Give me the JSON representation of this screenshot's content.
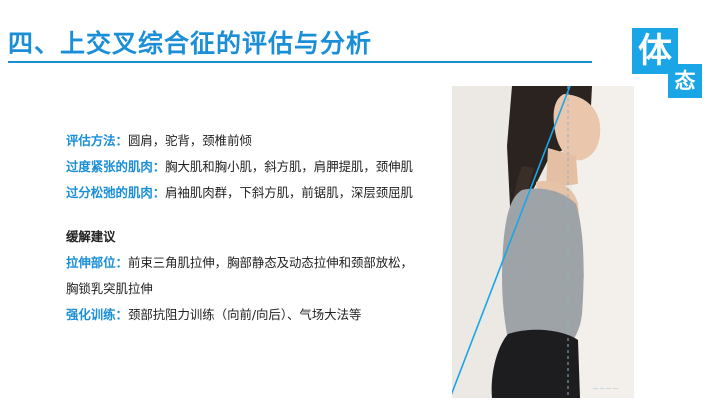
{
  "title": "四、上交叉综合征的评估与分析",
  "logo": {
    "big": "体",
    "small": "态"
  },
  "assessment": [
    {
      "label": "评估方法：",
      "text": "圆肩，驼背，颈椎前倾"
    },
    {
      "label": "过度紧张的肌肉：",
      "text": "胸大肌和胸小肌，斜方肌，肩胛提肌，颈伸肌"
    },
    {
      "label": "过分松弛的肌肉：",
      "text": "肩袖肌肉群，下斜方肌，前锯肌，深层颈屈肌"
    }
  ],
  "advice": {
    "heading": "缓解建议",
    "items": [
      {
        "label": "拉伸部位：",
        "text": "前束三角肌拉伸，胸部静态及动态拉伸和颈部放松，胸锁乳突肌拉伸"
      },
      {
        "label": "强化训练：",
        "text": "颈部抗阻力训练（向前/向后）、气场大法等"
      }
    ]
  },
  "photo": {
    "description": "posture-side-view"
  },
  "colors": {
    "accent": "#1a8fd8",
    "logo_bg": "#1aa6e6"
  }
}
